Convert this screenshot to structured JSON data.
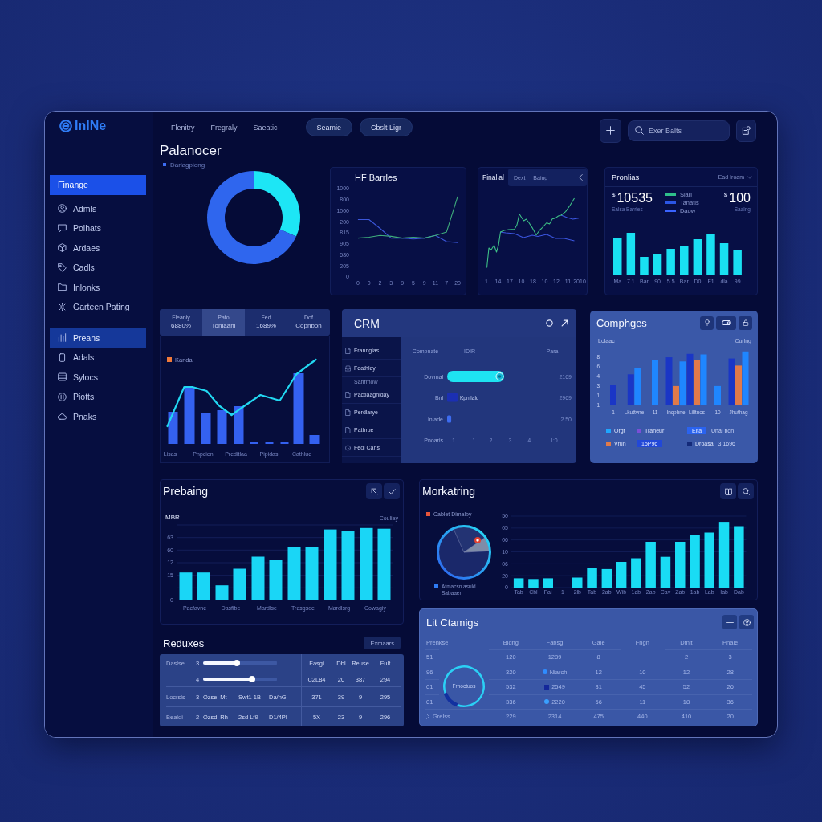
{
  "window": {
    "logo": "InINe"
  },
  "sidebar": {
    "sections": [
      {
        "items": [
          {
            "kind": "header",
            "label": "Finange",
            "selected": true,
            "highlighted": false
          },
          {
            "kind": "link",
            "label": "Admls",
            "selected": false,
            "highlighted": false
          },
          {
            "kind": "link",
            "label": "Polhats",
            "selected": false,
            "highlighted": false
          },
          {
            "kind": "link",
            "label": "Ardaes",
            "selected": false,
            "highlighted": false
          },
          {
            "kind": "link",
            "label": "Cadls",
            "selected": false,
            "highlighted": false
          },
          {
            "kind": "link",
            "label": "Inlonks",
            "selected": false,
            "highlighted": false
          },
          {
            "kind": "link",
            "label": "Garteen Pating",
            "selected": false,
            "highlighted": false
          }
        ]
      },
      {
        "items": [
          {
            "kind": "link",
            "label": "Preans",
            "selected": false,
            "highlighted": true
          },
          {
            "kind": "link",
            "label": "Adals",
            "selected": false,
            "highlighted": false
          },
          {
            "kind": "link",
            "label": "Sylocs",
            "selected": false,
            "highlighted": false
          },
          {
            "kind": "link",
            "label": "Piotts",
            "selected": false,
            "highlighted": false
          },
          {
            "kind": "link",
            "label": "Pnaks",
            "selected": false,
            "highlighted": false
          }
        ]
      }
    ]
  },
  "topbar": {
    "links": [
      "Flenitry",
      "Fregraly",
      "Saeatic"
    ],
    "buttons": [
      "Seamie",
      "Cbslt Ligr"
    ],
    "search": {
      "placeholder": "Exer Balts"
    }
  },
  "overview": {
    "title": "Palanocer",
    "subtitle": "Darlagpiong"
  },
  "hf_panel": {
    "title": "HF Barrles",
    "y_labels": [
      "1000",
      "800",
      "1000",
      "200",
      "815",
      "905",
      "580",
      "205",
      "0"
    ],
    "x_labels": [
      "0",
      "0",
      "2",
      "3",
      "9",
      "5",
      "9",
      "11",
      "7",
      "20"
    ]
  },
  "finalial": {
    "title": "Finalial",
    "tabs": [
      "Dext",
      "Baing"
    ],
    "x_labels": [
      "1",
      "14",
      "17",
      "10",
      "18",
      "10",
      "12",
      "11",
      "2010"
    ]
  },
  "pronlias": {
    "title": "Pronlias",
    "dropdown": "Ead Iroam",
    "stats": [
      {
        "currency": "$",
        "value": "10535",
        "label": "Salsa Barrles"
      },
      {
        "currency": "$",
        "value": "100",
        "label": "Saalng"
      }
    ],
    "legend": [
      {
        "label": "Siarl",
        "color": "#2fbf8a"
      },
      {
        "label": "Tanatis",
        "color": "#2b56e6"
      },
      {
        "label": "Daow",
        "color": "#3a63ff"
      }
    ],
    "x_labels": [
      "Ma",
      "7.1",
      "Bar",
      "90",
      "5.5",
      "Bar",
      "D0",
      "F1",
      "dla",
      "99"
    ]
  },
  "kanda": {
    "tabs": [
      {
        "label": "Fleaniy",
        "value": "6880%",
        "selected": false
      },
      {
        "label": "Pato",
        "value": "Tonlaanl",
        "selected": true
      },
      {
        "label": "Fed",
        "value": "1689%",
        "selected": false
      },
      {
        "label": "Dof",
        "value": "Cophbon",
        "selected": false
      }
    ],
    "legend": "Kanda",
    "x_labels": [
      "Lisas",
      "Pnpcien",
      "Preditlaa",
      "Pipidas",
      "Cathlue"
    ]
  },
  "crm": {
    "title": "CRM",
    "menu": [
      {
        "label": "Franngias"
      },
      {
        "label": "Feathley",
        "note": "Sahrmow"
      },
      {
        "label": "Pactlaagnlday"
      },
      {
        "label": "Perdlarye"
      },
      {
        "label": "Pathrue"
      },
      {
        "label": "Fedl Cans"
      }
    ],
    "columns": [
      "Compnate",
      "IDIR",
      "Para"
    ],
    "rows": [
      {
        "label": "Dovmal",
        "value": "2169"
      },
      {
        "label": "Bnl",
        "value": "2969",
        "note": "Kpn lald"
      },
      {
        "label": "Inlade",
        "value": "2.50"
      }
    ],
    "axis_label": "Pnoaris",
    "axis_ticks": [
      "1",
      "1",
      "2",
      "3",
      "4",
      "1:0"
    ]
  },
  "comphges": {
    "title": "Comphges",
    "axis_label": "Lolaac",
    "corner_label": "Curlng",
    "y_labels": [
      "8",
      "6",
      "4",
      "3",
      "1",
      "1"
    ],
    "x_labels": [
      "1",
      "Lkuttvne",
      "11",
      "Incphne",
      "Lilltnos",
      "10",
      "Jhuthag"
    ],
    "legend": [
      {
        "kind": "swatch",
        "label": "Orgt",
        "color": "#1ea7ff"
      },
      {
        "kind": "swatch",
        "label": "Traneur",
        "color": "#7b4fd6"
      },
      {
        "kind": "chip",
        "label": "Elta",
        "color": "#2a63f0",
        "value": "Uhai bon"
      },
      {
        "kind": "swatch",
        "label": "Vruh",
        "color": "#e07a4a"
      },
      {
        "kind": "chip",
        "label": "15P96",
        "color": "#2248d8"
      },
      {
        "kind": "swatch",
        "label": "Droasa",
        "color": "#142a7a",
        "value": "3.1696"
      }
    ]
  },
  "prebaing": {
    "title": "Prebaing",
    "axis_label": "MBR",
    "corner_label": "Couliay",
    "y_labels": [
      "63",
      "60",
      "12",
      "15",
      "0"
    ],
    "x_labels": [
      "Pacfavne",
      "Dasfibe",
      "Mardlse",
      "Trasgsde",
      "Mardlsrg",
      "Cowagiy"
    ]
  },
  "reduxes": {
    "title": "Reduxes",
    "button": "Exmaars",
    "rows": [
      {
        "kind": "slider",
        "label": "Daslse",
        "index": "3",
        "level": 0.48,
        "cells": [
          "Fasgi",
          "Dbl",
          "Reuse",
          "Fult"
        ]
      },
      {
        "kind": "slider",
        "index": "4",
        "level": 0.68,
        "cells": [
          "C2L84",
          "20",
          "387",
          "294"
        ]
      },
      {
        "kind": "text",
        "label": "Locrsls",
        "index": "3",
        "cells": [
          "Ozsel Mt",
          "Swt1 1B",
          "Da/nG",
          "371",
          "39",
          "9",
          "295"
        ]
      },
      {
        "kind": "text",
        "label": "Bealdi",
        "index": "2",
        "cells": [
          "Ozsdi Rh",
          "2sd Lf9",
          "D1/4PI",
          "5X",
          "23",
          "9",
          "296"
        ]
      }
    ]
  },
  "morkatring": {
    "title": "Morkatring",
    "pie_legend": "Cablet Dimalby",
    "pie_caption": "Afmacsn asuld Sabaaer",
    "y_labels": [
      "50",
      "05",
      "06",
      "10",
      "06",
      "20",
      "0"
    ],
    "x_labels": [
      "Tab",
      "Cbl",
      "Fai",
      "1",
      "2lb",
      "Tab",
      "2ab",
      "Wib",
      "1ab",
      "2ab",
      "Cav",
      "Zab",
      "1ab",
      "Lab",
      "Iab",
      "Dab"
    ]
  },
  "lit_ctamigs": {
    "title": "Lit Ctamigs",
    "donut_label": "Frnoctuos",
    "columns": [
      "Prenkse",
      "Bldng",
      "Fabsg",
      "Gaie",
      "Fhgh",
      "Dfnlt",
      "Pnale"
    ],
    "rows": [
      {
        "kind": "row",
        "cells": [
          "51",
          "120",
          "1289",
          "8",
          null,
          "2",
          "3"
        ]
      },
      {
        "kind": "row",
        "cells": [
          "96",
          "320",
          "Niarch",
          "12",
          "10",
          "12",
          "28"
        ],
        "marker": {
          "kind": "circle",
          "color": "#2f8cff"
        }
      },
      {
        "kind": "row",
        "cells": [
          "01",
          "532",
          "2549",
          "31",
          "45",
          "52",
          "26"
        ],
        "marker": {
          "kind": "square",
          "color": "#14289a"
        }
      },
      {
        "kind": "row",
        "cells": [
          "01",
          "336",
          "2220",
          "56",
          "11",
          "18",
          "36"
        ],
        "marker": {
          "kind": "circle",
          "color": "#3aa0ff"
        }
      },
      {
        "kind": "group",
        "cells": [
          "Grelss",
          "229",
          "2314",
          "475",
          "440",
          "410",
          "20"
        ]
      }
    ]
  }
}
